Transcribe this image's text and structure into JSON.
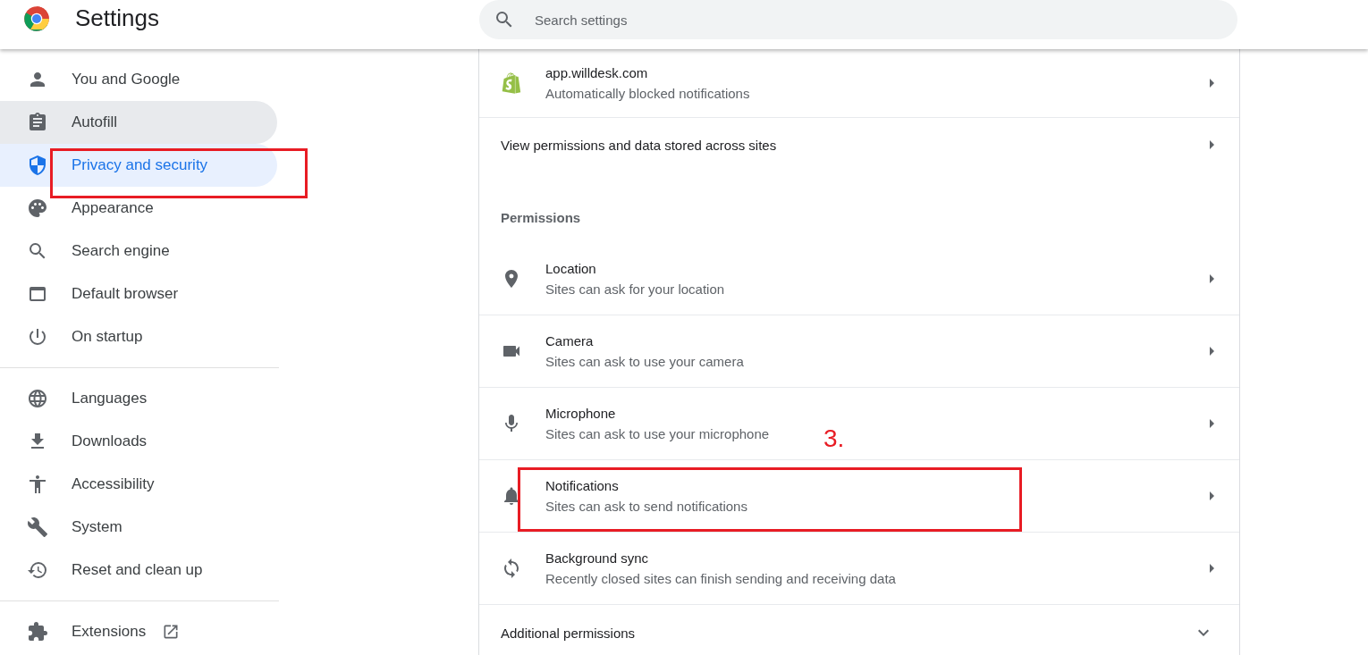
{
  "header": {
    "title": "Settings",
    "search": {
      "placeholder": "Search settings"
    }
  },
  "sidebar": {
    "groups": [
      {
        "items": [
          {
            "label": "You and Google",
            "selected": false,
            "hovered": false,
            "annotated": false
          },
          {
            "label": "Autofill",
            "selected": false,
            "hovered": true,
            "annotated": false
          },
          {
            "label": "Privacy and security",
            "selected": true,
            "hovered": false,
            "annotated": true
          },
          {
            "label": "Appearance",
            "selected": false,
            "hovered": false,
            "annotated": false
          },
          {
            "label": "Search engine",
            "selected": false,
            "hovered": false,
            "annotated": false
          },
          {
            "label": "Default browser",
            "selected": false,
            "hovered": false,
            "annotated": false
          },
          {
            "label": "On startup",
            "selected": false,
            "hovered": false,
            "annotated": false
          }
        ]
      },
      {
        "items": [
          {
            "label": "Languages",
            "selected": false,
            "hovered": false,
            "annotated": false
          },
          {
            "label": "Downloads",
            "selected": false,
            "hovered": false,
            "annotated": false
          },
          {
            "label": "Accessibility",
            "selected": false,
            "hovered": false,
            "annotated": false
          },
          {
            "label": "System",
            "selected": false,
            "hovered": false,
            "annotated": false
          },
          {
            "label": "Reset and clean up",
            "selected": false,
            "hovered": false,
            "annotated": false
          }
        ]
      },
      {
        "items": [
          {
            "label": "Extensions",
            "selected": false,
            "hovered": false,
            "annotated": false,
            "external": true
          }
        ]
      }
    ]
  },
  "content": {
    "rows": [
      {
        "kind": "site",
        "title": "app.willdesk.com",
        "subtitle": "Automatically blocked notifications"
      },
      {
        "kind": "link",
        "title": "View permissions and data stored across sites"
      },
      {
        "kind": "heading",
        "title": "Permissions"
      },
      {
        "kind": "permission",
        "title": "Location",
        "subtitle": "Sites can ask for your location",
        "annotated": false
      },
      {
        "kind": "permission",
        "title": "Camera",
        "subtitle": "Sites can ask to use your camera",
        "annotated": false
      },
      {
        "kind": "permission",
        "title": "Microphone",
        "subtitle": "Sites can ask to use your microphone",
        "annotated": false
      },
      {
        "kind": "permission",
        "title": "Notifications",
        "subtitle": "Sites can ask to send notifications",
        "annotated": true,
        "step_label": "3."
      },
      {
        "kind": "permission",
        "title": "Background sync",
        "subtitle": "Recently closed sites can finish sending and receiving data",
        "annotated": false
      },
      {
        "kind": "expander",
        "title": "Additional permissions",
        "expanded": false
      }
    ]
  }
}
